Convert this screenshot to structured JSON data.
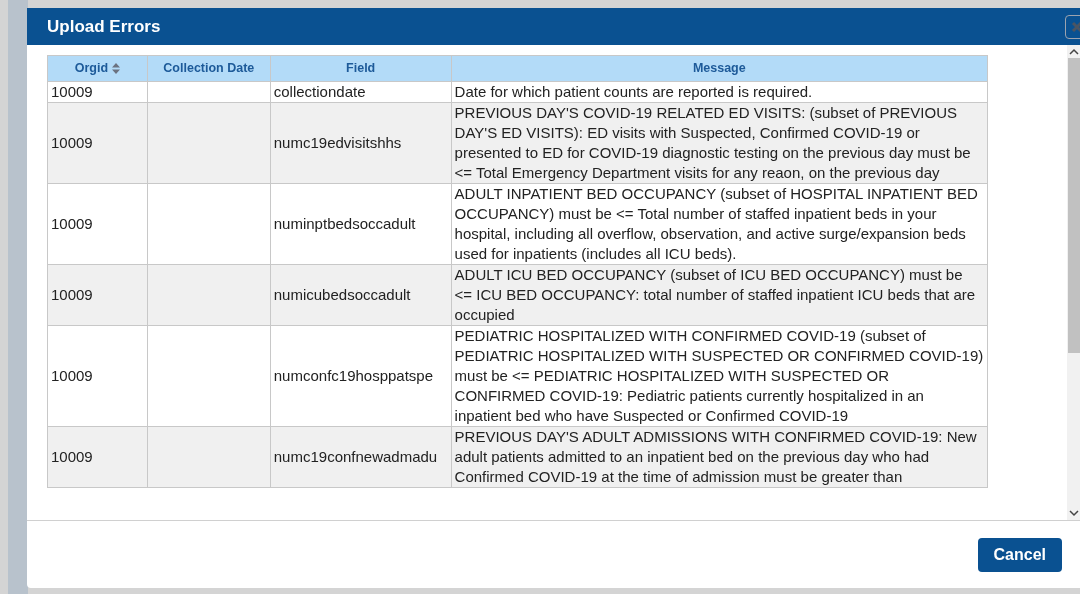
{
  "dialog": {
    "title": "Upload Errors"
  },
  "table": {
    "columns": [
      {
        "label": "Orgid",
        "sortable": true
      },
      {
        "label": "Collection Date",
        "sortable": false
      },
      {
        "label": "Field",
        "sortable": false
      },
      {
        "label": "Message",
        "sortable": false
      }
    ],
    "rows": [
      {
        "orgid": "10009",
        "collection_date": "",
        "field": "collectiondate",
        "message": "Date for which patient counts are reported is required."
      },
      {
        "orgid": "10009",
        "collection_date": "",
        "field": "numc19edvisitshhs",
        "message": "PREVIOUS DAY'S COVID-19 RELATED ED VISITS:  (subset of PREVIOUS DAY'S ED VISITS): ED visits with Suspected, Confirmed COVID-19 or presented to ED for COVID-19 diagnostic testing on the previous day must be <=  Total Emergency Department visits for any reaon, on the previous day"
      },
      {
        "orgid": "10009",
        "collection_date": "",
        "field": "numinptbedsoccadult",
        "message": "ADULT INPATIENT BED OCCUPANCY (subset of HOSPITAL INPATIENT BED OCCUPANCY)  must be <= Total number of staffed inpatient beds in your hospital, including all overflow, observation, and active surge/expansion beds used for inpatients (includes all ICU beds)."
      },
      {
        "orgid": "10009",
        "collection_date": "",
        "field": "numicubedsoccadult",
        "message": "ADULT ICU BED OCCUPANCY (subset of ICU BED OCCUPANCY) must be <= ICU BED OCCUPANCY: total number of staffed inpatient ICU beds that are occupied"
      },
      {
        "orgid": "10009",
        "collection_date": "",
        "field": "numconfc19hosppatspe",
        "message": "PEDIATRIC HOSPITALIZED WITH CONFIRMED COVID-19 (subset of PEDIATRIC HOSPITALIZED WITH SUSPECTED OR CONFIRMED COVID-19) must be <= PEDIATRIC HOSPITALIZED WITH SUSPECTED OR CONFIRMED COVID-19: Pediatric patients currently hospitalized in an inpatient bed who have Suspected or Confirmed COVID-19"
      },
      {
        "orgid": "10009",
        "collection_date": "",
        "field": "numc19confnewadmadu",
        "message": "PREVIOUS DAY'S ADULT ADMISSIONS WITH CONFIRMED COVID-19: New adult patients admitted to an inpatient bed on the previous day who had Confirmed COVID-19 at the time of admission must be greater than"
      }
    ]
  },
  "buttons": [
    {
      "label": "Cancel"
    }
  ]
}
